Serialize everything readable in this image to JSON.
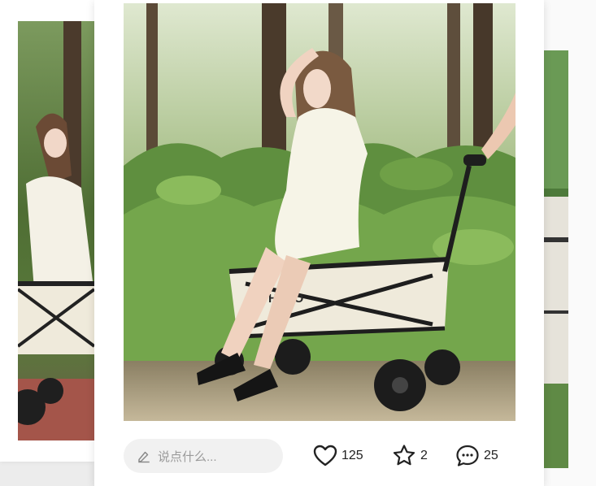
{
  "post": {
    "comment_placeholder": "说点什么...",
    "likes": "125",
    "favorites": "2",
    "comments": "25"
  },
  "photo": {
    "brand_print": "HNSO"
  },
  "colors": {
    "background": "#ececec",
    "card": "#ffffff",
    "input_bg": "#f1f1f1",
    "placeholder": "#9a9a9a",
    "foliage": "#5f8f3f",
    "cart": "#efeadb"
  },
  "icons": {
    "comment_box": "pencil-icon",
    "like": "heart-icon",
    "favorite": "star-icon",
    "comment": "speech-bubble-icon"
  }
}
